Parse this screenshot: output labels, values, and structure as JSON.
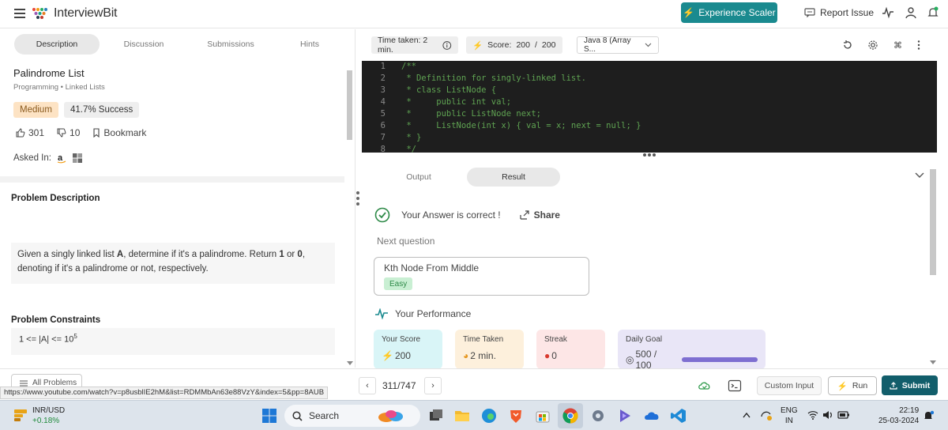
{
  "header": {
    "brand": "InterviewBit",
    "experience_button": "Experience Scaler",
    "report_issue": "Report Issue"
  },
  "left_panel": {
    "tabs": [
      "Description",
      "Discussion",
      "Submissions",
      "Hints"
    ],
    "active_tab": "Description",
    "title": "Palindrome List",
    "breadcrumb": [
      "Programming",
      "Linked Lists"
    ],
    "difficulty": "Medium",
    "success": "41.7% Success",
    "likes": "301",
    "dislikes": "10",
    "bookmark": "Bookmark",
    "asked_in": "Asked In:",
    "problem_description_heading": "Problem Description",
    "description": {
      "p1": "Given a singly linked list ",
      "b1": "A",
      "p2": ", determine if it's a palindrome. Return ",
      "b2": "1",
      "p3": " or ",
      "b3": "0",
      "p4": ", denoting if it's a palindrome or not, respectively."
    },
    "constraints_heading": "Problem Constraints",
    "constraint_base": "1 <= |A| <= 10",
    "constraint_exp": "5"
  },
  "editor_toolbar": {
    "time_taken": "Time taken: 2 min.",
    "score_label": "Score:",
    "score_value": "200",
    "score_sep": "/",
    "score_max": "200",
    "language": "Java 8 (Array S..."
  },
  "code": {
    "lines": [
      {
        "n": "1",
        "text": "/**"
      },
      {
        "n": "2",
        "text": " * Definition for singly-linked list."
      },
      {
        "n": "3",
        "text": " * class ListNode {"
      },
      {
        "n": "4",
        "text": " *     public int val;"
      },
      {
        "n": "5",
        "text": " *     public ListNode next;"
      },
      {
        "n": "6",
        "text": " *     ListNode(int x) { val = x; next = null; }"
      },
      {
        "n": "7",
        "text": " * }"
      },
      {
        "n": "8",
        "text": " */"
      }
    ]
  },
  "result": {
    "tabs": [
      "Output",
      "Result"
    ],
    "active_tab": "Result",
    "correct_message": "Your Answer is correct !",
    "share": "Share",
    "next_question_label": "Next question",
    "next_question_title": "Kth Node From Middle",
    "next_question_difficulty": "Easy",
    "performance_heading": "Your Performance",
    "cards": [
      {
        "label": "Your Score",
        "value": "200"
      },
      {
        "label": "Time Taken",
        "value": "2 min."
      },
      {
        "label": "Streak",
        "value": "0"
      },
      {
        "label": "Daily Goal",
        "value": "500 / 100"
      }
    ],
    "daily_goal_progress": 1.0
  },
  "bottom_bar": {
    "all_problems": "All Problems",
    "counter": "311/747",
    "custom_input": "Custom Input",
    "run": "Run",
    "submit": "Submit",
    "url_tooltip": "https://www.youtube.com/watch?v=p8usblIE2hM&list=RDMMbAn63e88VzY&index=5&pp=8AUB"
  },
  "taskbar": {
    "ticker_name": "INR/USD",
    "ticker_change": "+0.18%",
    "search": "Search",
    "lang_line1": "ENG",
    "lang_line2": "IN",
    "time": "22:19",
    "date": "25-03-2024"
  },
  "colors": {
    "accent_teal": "#1a8a8f",
    "submit": "#125e6b",
    "medium_badge": "#fde3c4",
    "easy_badge": "#c9efd3",
    "correct_green": "#2e8a48"
  }
}
